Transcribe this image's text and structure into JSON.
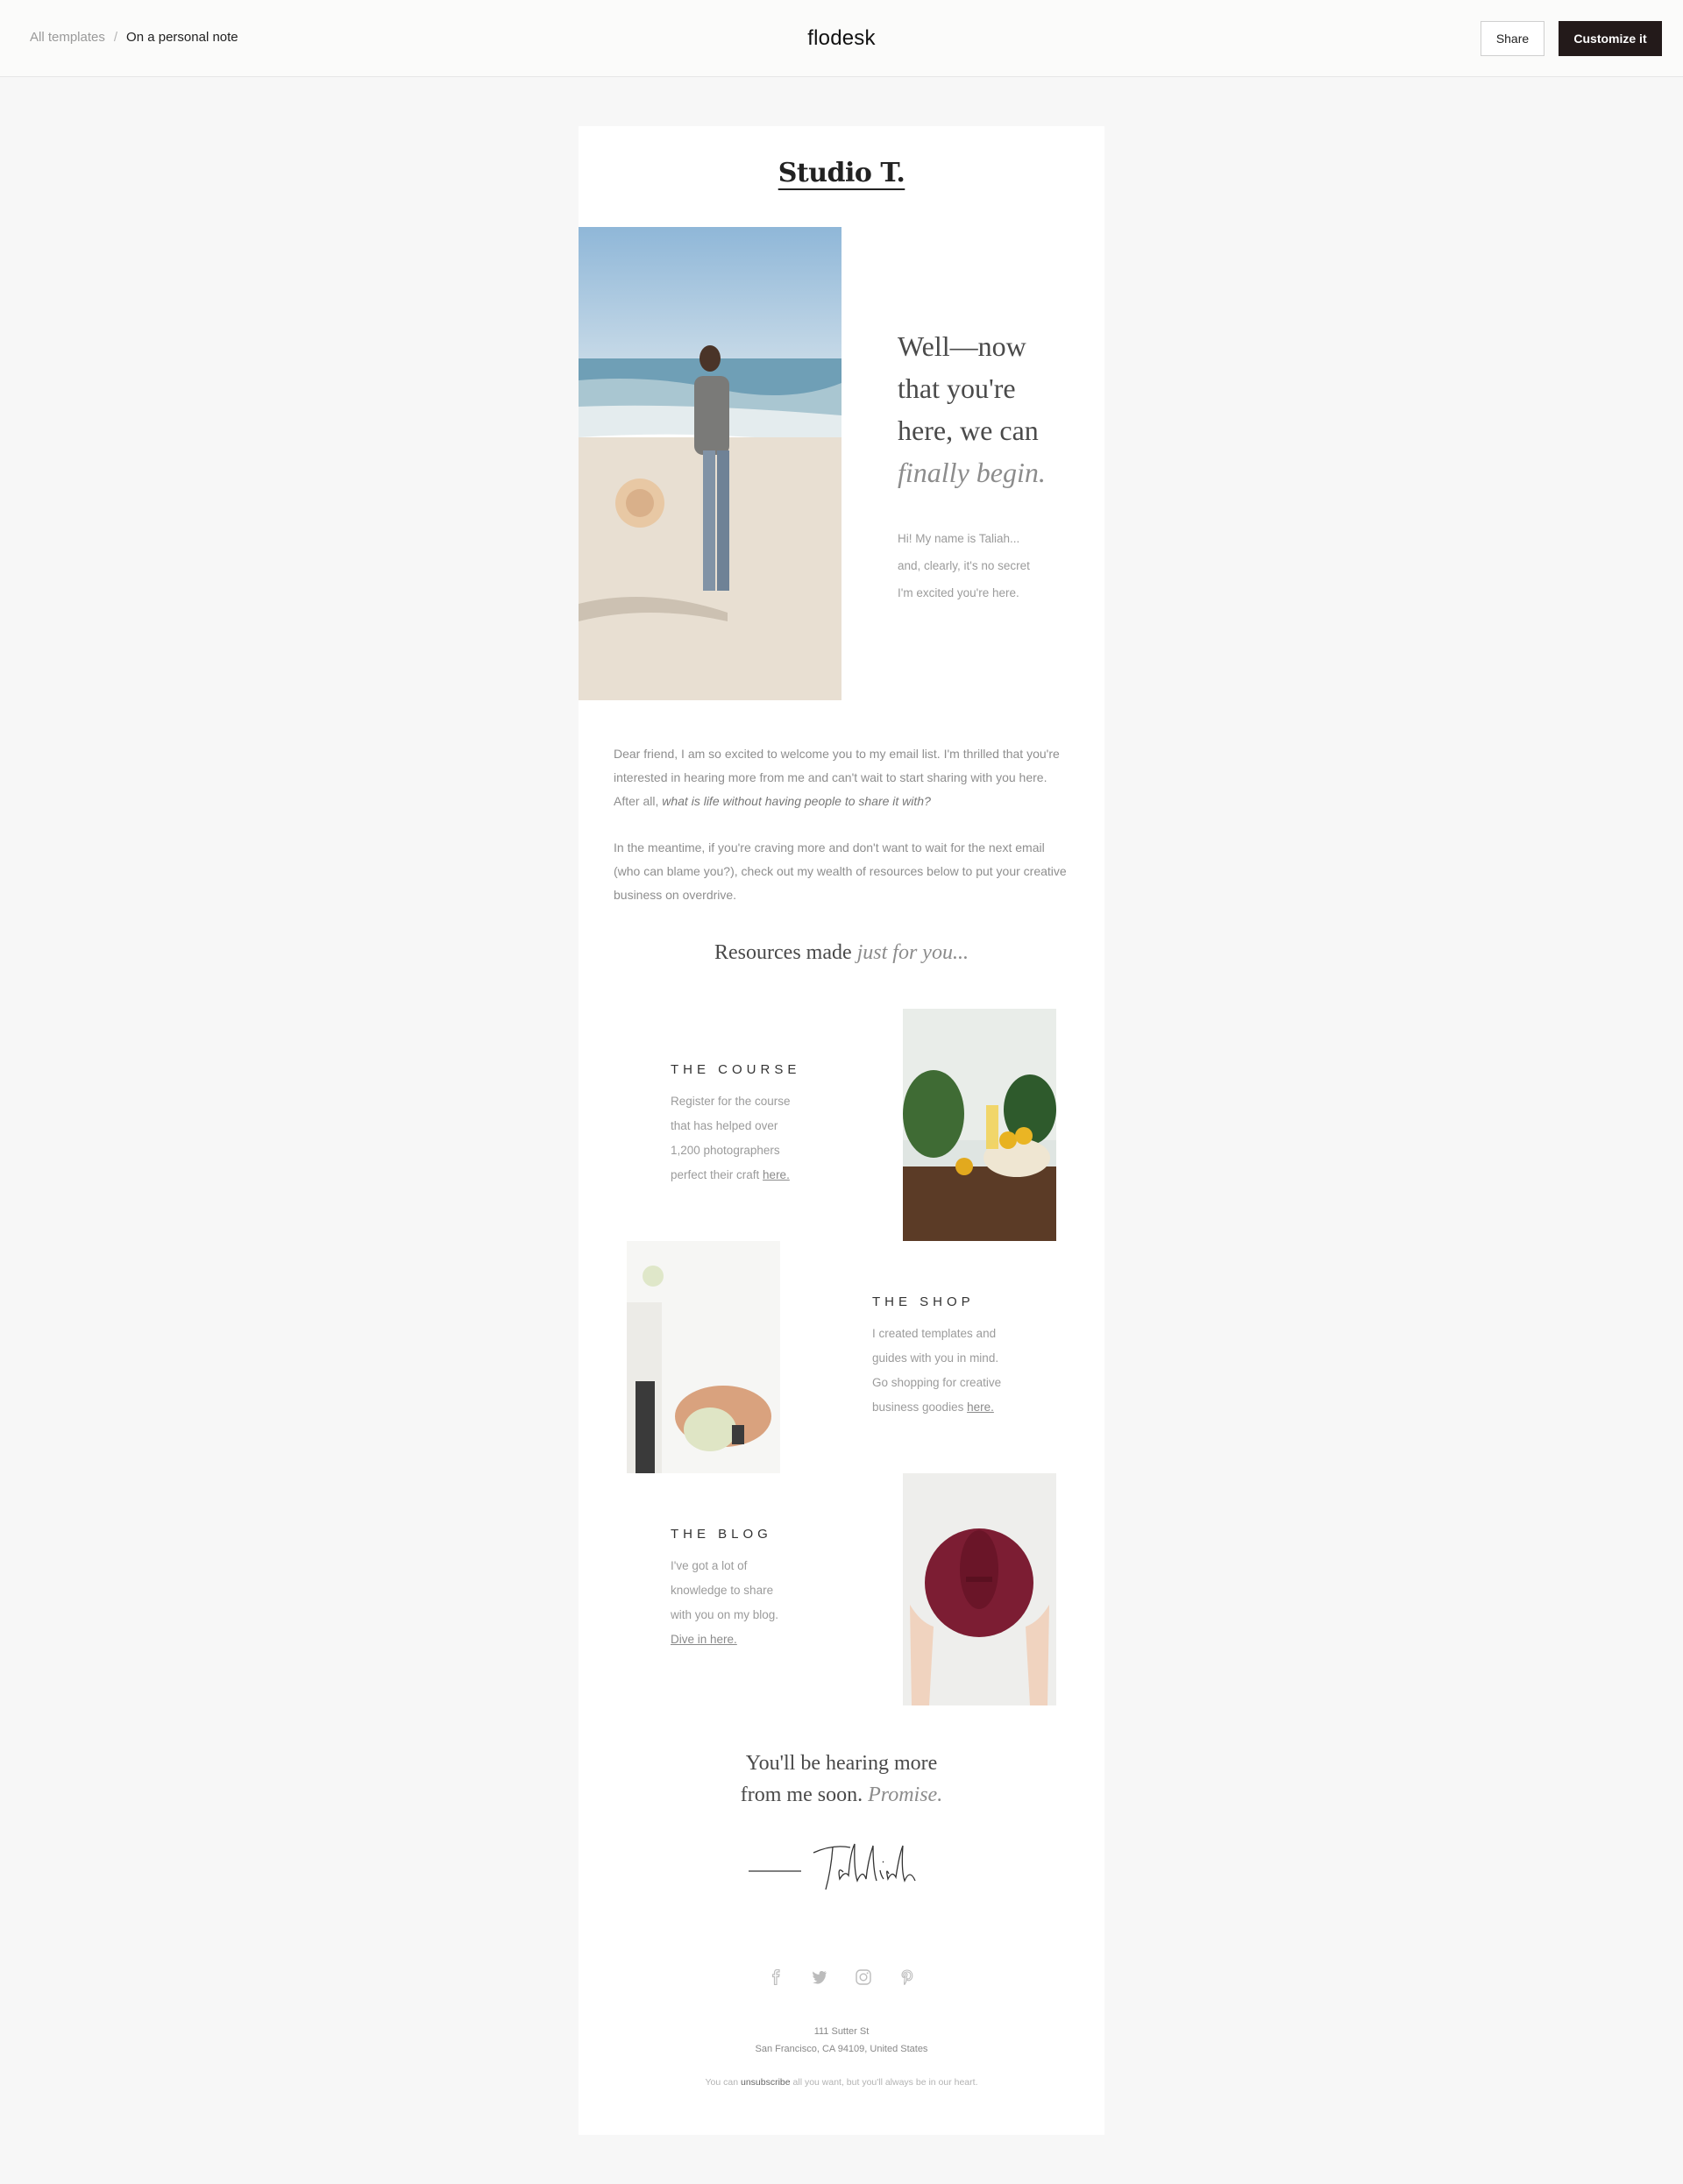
{
  "topbar": {
    "breadcrumb_root": "All templates",
    "breadcrumb_sep": "/",
    "breadcrumb_current": "On a personal note",
    "brand": "flodesk",
    "share_label": "Share",
    "customize_label": "Customize it"
  },
  "email": {
    "logo": "Studio T.",
    "hero": {
      "heading_line1": "Well—now",
      "heading_line2": "that you're",
      "heading_line3": "here, we can",
      "heading_italic": "finally begin.",
      "sub_line1": "Hi! My name is Taliah...",
      "sub_line2": "and, clearly, it's no secret",
      "sub_line3": "I'm excited you're here."
    },
    "intro": {
      "p1_line1": "Dear friend, I am so excited to welcome you to my email list. I'm thrilled that you're",
      "p1_line2": "interested in hearing more from me and can't wait to start sharing with you here.",
      "p1_line3_start": "After all, ",
      "p1_line3_italic": "what is life without having people to share it with?",
      "p2_line1": "In the meantime, if you're craving more and don't want to wait for the next email",
      "p2_line2": "(who can blame you?), check out my wealth of resources below to put your creative",
      "p2_line3": "business on overdrive."
    },
    "resources_title": "Resources made ",
    "resources_title_italic": "just for you...",
    "course": {
      "title": "THE COURSE",
      "line1": "Register for the course",
      "line2": "that has helped over",
      "line3": "1,200 photographers",
      "line4": "perfect their craft ",
      "link": "here."
    },
    "shop": {
      "title": "THE SHOP",
      "line1": "I created templates and",
      "line2": "guides with you in mind.",
      "line3": "Go shopping for creative",
      "line4": "business goodies ",
      "link": "here."
    },
    "blog": {
      "title": "THE BLOG",
      "line1": "I've got a lot of",
      "line2": "knowledge to share",
      "line3": "with you on my blog.",
      "link": "Dive in here."
    },
    "closing_line1": "You'll be hearing more",
    "closing_line2": "from me soon. ",
    "closing_italic": "Promise.",
    "signature": "Tahliah",
    "address_line1": "111 Sutter St",
    "address_line2": "San Francisco, CA 94109, United States",
    "footer_pre": "You can ",
    "footer_link": "unsubscribe",
    "footer_post": " all you want, but you'll always be in our heart."
  }
}
